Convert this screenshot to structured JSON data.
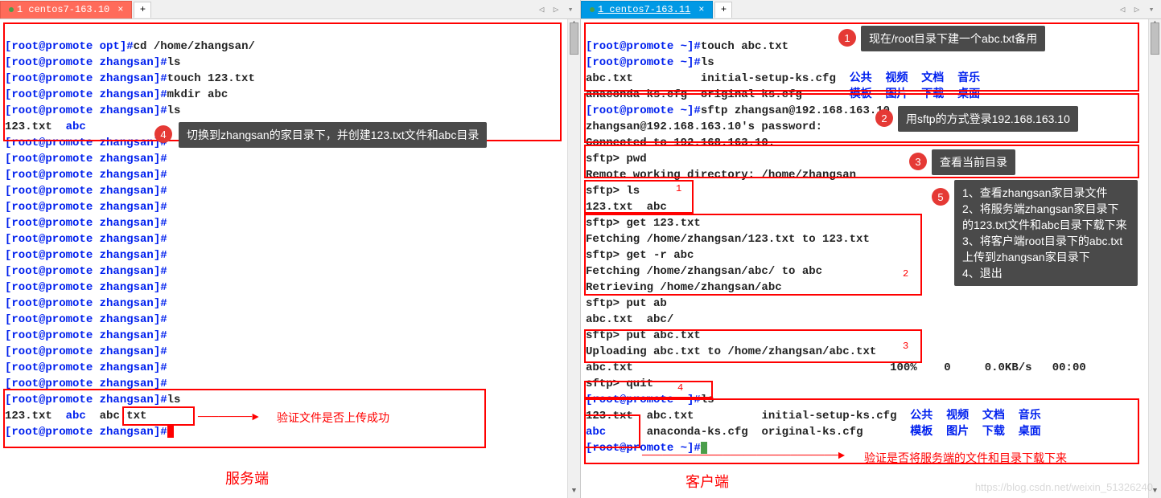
{
  "tabs": {
    "left": "1 centos7-163.10",
    "right": "1 centos7-163.11",
    "add": "+"
  },
  "left": {
    "lines": {
      "l1_prompt": "[root@promote opt]#",
      "l1_cmd": "cd /home/zhangsan/",
      "l2_prompt": "[root@promote zhangsan]#",
      "l2_cmd": "ls",
      "l3_prompt": "[root@promote zhangsan]#",
      "l3_cmd": "touch 123.txt",
      "l4_prompt": "[root@promote zhangsan]#",
      "l4_cmd": "mkdir abc",
      "l5_prompt": "[root@promote zhangsan]#",
      "l5_cmd": "ls",
      "l6_a": "123.txt  ",
      "l6_b": "abc",
      "empty_prompt": "[root@promote zhangsan]#",
      "l_ls_prompt": "[root@promote zhangsan]#",
      "l_ls_cmd": "ls",
      "l_out_a": "123.txt  ",
      "l_out_b": "abc",
      "l_out_c": "  abc.txt"
    },
    "callouts": {
      "c4": "切换到zhangsan的家目录下，并创建123.txt文件和abc目录",
      "verify": "验证文件是否上传成功"
    },
    "footer": "服务端"
  },
  "right": {
    "lines": {
      "r1_prompt": "[root@promote ~]#",
      "r1_cmd": "touch abc.txt",
      "r2_prompt": "[root@promote ~]#",
      "r2_cmd": "ls",
      "r3_a": "abc.txt          initial-setup-ks.cfg  ",
      "r3_b": "公共  视频  文档  音乐",
      "r4_a": "anaconda-ks.cfg  original-ks.cfg       ",
      "r4_b": "模板  图片  下载  桌面",
      "r5_prompt": "[root@promote ~]#",
      "r5_cmd": "sftp zhangsan@192.168.163.10",
      "r6": "zhangsan@192.168.163.10's password: ",
      "r7": "Connected to 192.168.163.10.",
      "r8": "sftp> pwd",
      "r9": "Remote working directory: /home/zhangsan",
      "r10": "sftp> ls",
      "r11": "123.txt  abc   ",
      "r12": "sftp> get 123.txt",
      "r13": "Fetching /home/zhangsan/123.txt to 123.txt",
      "r14": "sftp> get -r abc",
      "r15": "Fetching /home/zhangsan/abc/ to abc",
      "r16": "Retrieving /home/zhangsan/abc",
      "r17": "sftp> put ab",
      "r18": "abc.txt  abc/  ",
      "r19": "sftp> put abc.txt",
      "r20": "Uploading abc.txt to /home/zhangsan/abc.txt",
      "r21_a": "abc.txt",
      "r21_b": "100%",
      "r21_c": "0",
      "r21_d": "0.0KB/s",
      "r21_e": "00:00",
      "r22": "sftp> quit",
      "r23_prompt": "[root@promote ~]#",
      "r23_cmd": "ls",
      "r24_a": "123.txt",
      "r24_b": "  abc.txt          initial-setup-ks.cfg  ",
      "r24_c": "公共  视频  文档  音乐",
      "r25_a": "abc",
      "r25_b": "      anaconda-ks.cfg  original-ks.cfg       ",
      "r25_c": "模板  图片  下载  桌面",
      "r26_prompt": "[root@promote ~]#"
    },
    "callouts": {
      "c1": "现在/root目录下建一个abc.txt备用",
      "c2": "用sftp的方式登录192.168.163.10",
      "c3": "查看当前目录",
      "c5": "1、查看zhangsan家目录文件\n2、将服务端zhangsan家目录下的123.txt文件和abc目录下载下来\n3、将客户端root目录下的abc.txt上传到zhangsan家目录下\n4、退出",
      "verify": "验证是否将服务端的文件和目录下载下来"
    },
    "tinynums": {
      "n1": "1",
      "n2": "2",
      "n3": "3",
      "n4": "4"
    },
    "footer": "客户端"
  },
  "badges": {
    "b1": "1",
    "b2": "2",
    "b3": "3",
    "b4": "4",
    "b5": "5"
  },
  "watermark": "https://blog.csdn.net/weixin_51326240"
}
